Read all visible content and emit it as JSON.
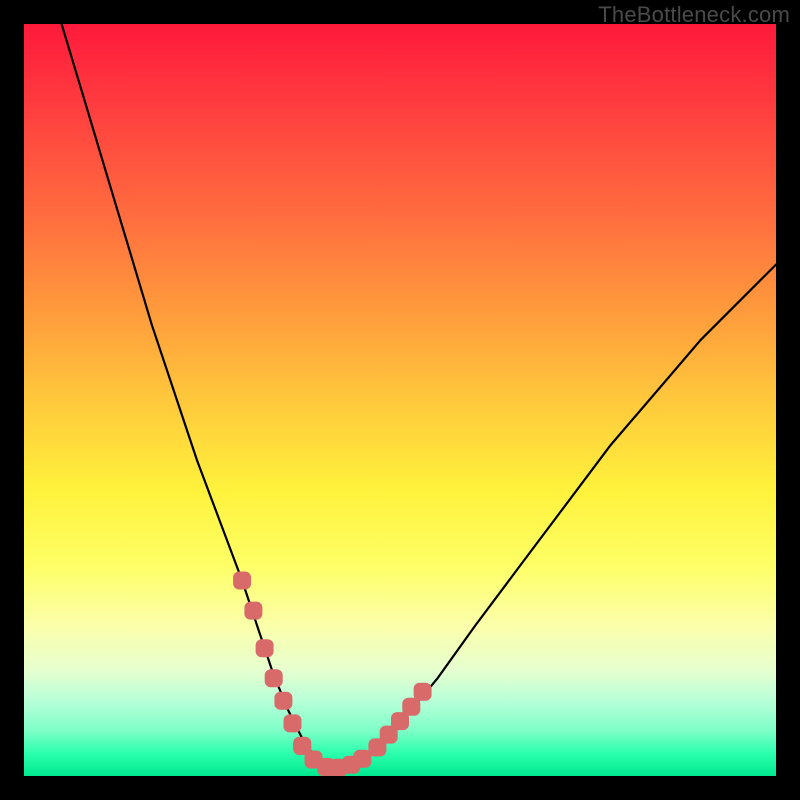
{
  "watermark": "TheBottleneck.com",
  "chart_data": {
    "type": "line",
    "title": "",
    "xlabel": "",
    "ylabel": "",
    "xlim": [
      0,
      100
    ],
    "ylim": [
      0,
      100
    ],
    "series": [
      {
        "name": "bottleneck-curve",
        "x": [
          5,
          8,
          11,
          14,
          17,
          20,
          23,
          26,
          29,
          31,
          33,
          35,
          37,
          39,
          41,
          45,
          50,
          55,
          60,
          66,
          72,
          78,
          84,
          90,
          96,
          100
        ],
        "values": [
          100,
          90,
          80,
          70,
          60,
          51,
          42,
          34,
          26,
          20,
          14,
          9,
          5,
          2,
          1,
          2,
          7,
          13,
          20,
          28,
          36,
          44,
          51,
          58,
          64,
          68
        ]
      },
      {
        "name": "highlight-left",
        "x": [
          29,
          30.5,
          32,
          33.2,
          34.5,
          35.7,
          37
        ],
        "values": [
          26,
          22,
          17,
          13,
          10,
          7,
          4
        ]
      },
      {
        "name": "highlight-bottom",
        "x": [
          37,
          38.5,
          40.2,
          41.8,
          43.5,
          45
        ],
        "values": [
          4,
          2.2,
          1.2,
          1.1,
          1.5,
          2.3
        ]
      },
      {
        "name": "highlight-right",
        "x": [
          47,
          48.5,
          50,
          51.5,
          53
        ],
        "values": [
          3.8,
          5.5,
          7.3,
          9.2,
          11.2
        ]
      }
    ],
    "colors": {
      "curve": "#000000",
      "highlight": "#d86a6a",
      "gradient_top": "#ff1a3c",
      "gradient_bottom": "#00e88f"
    }
  }
}
